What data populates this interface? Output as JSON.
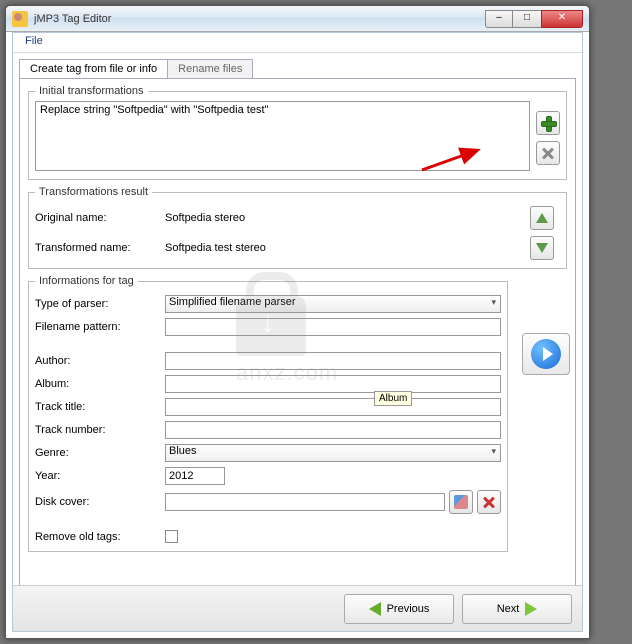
{
  "title": "jMP3 Tag Editor",
  "menu": {
    "file": "File"
  },
  "tabs": {
    "create": "Create tag from file or info",
    "rename": "Rename files"
  },
  "initial_transformations": {
    "legend": "Initial transformations",
    "item": "Replace string \"Softpedia\" with \"Softpedia test\""
  },
  "result": {
    "legend": "Transformations result",
    "original_label": "Original name:",
    "original_value": "Softpedia stereo",
    "transformed_label": "Transformed name:",
    "transformed_value": "Softpedia test stereo"
  },
  "info": {
    "legend": "Informations for tag",
    "parser_label": "Type of parser:",
    "parser_value": "Simplified filename parser",
    "pattern_label": "Filename pattern:",
    "pattern_value": "",
    "author_label": "Author:",
    "author_value": "",
    "album_label": "Album:",
    "album_value": "",
    "title_label": "Track title:",
    "title_value": "",
    "number_label": "Track number:",
    "number_value": "",
    "genre_label": "Genre:",
    "genre_value": "Blues",
    "year_label": "Year:",
    "year_value": "2012",
    "cover_label": "Disk cover:",
    "cover_value": "",
    "remove_label": "Remove old tags:"
  },
  "tooltip": "Album",
  "nav": {
    "prev": "Previous",
    "next": "Next"
  },
  "watermark": "anxz.com"
}
